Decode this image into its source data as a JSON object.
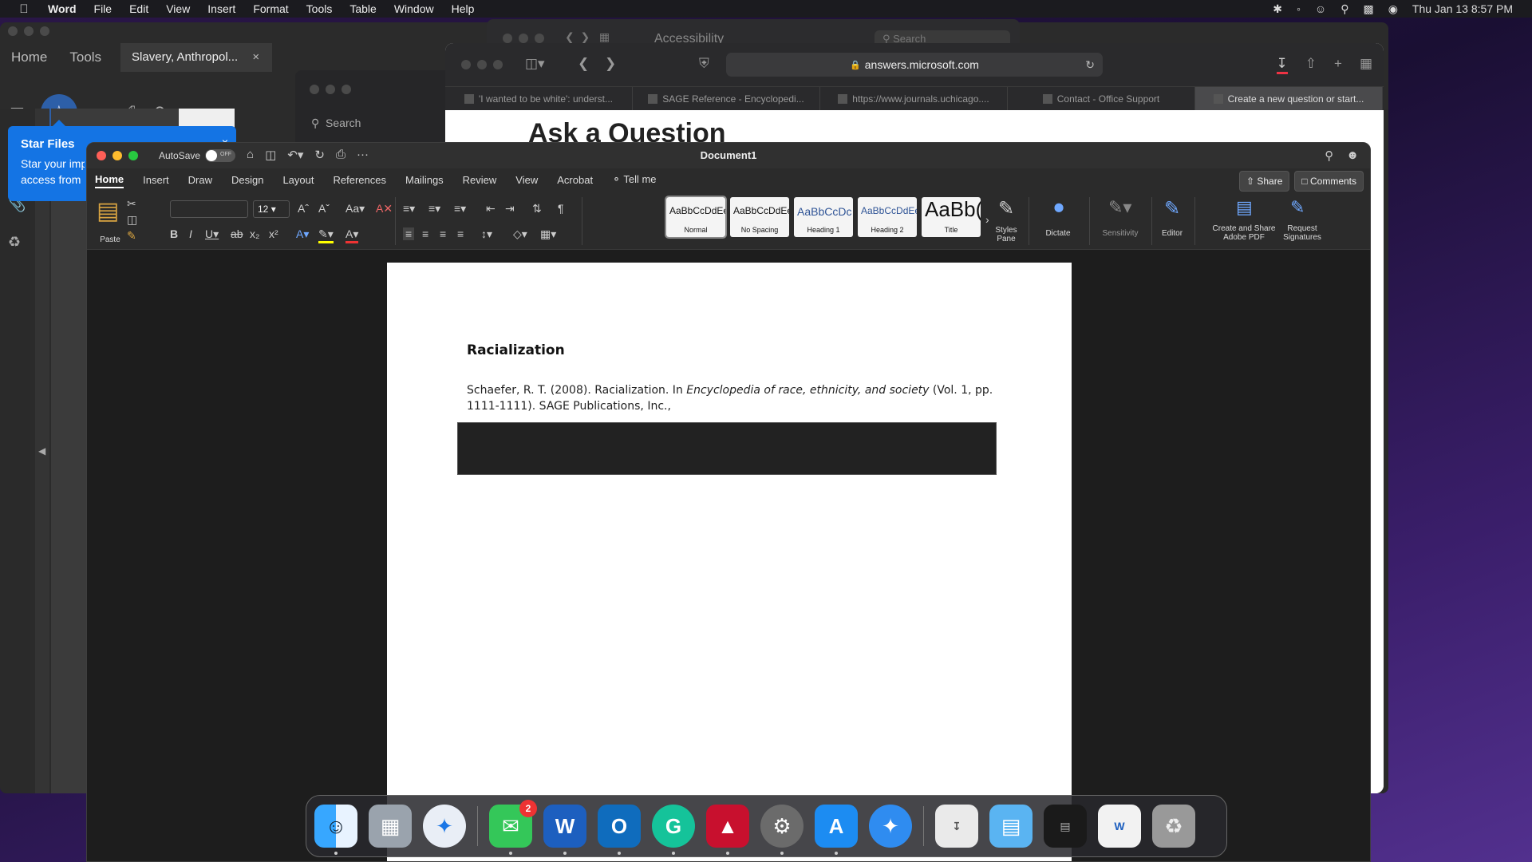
{
  "menubar": {
    "app": "Word",
    "items": [
      "File",
      "Edit",
      "View",
      "Insert",
      "Format",
      "Tools",
      "Table",
      "Window",
      "Help"
    ],
    "clock": "Thu Jan 13  8:57 PM"
  },
  "acrobat": {
    "tabs": {
      "home": "Home",
      "tools": "Tools",
      "doc": "Slavery, Anthropol...",
      "close": "×"
    },
    "star_popup": {
      "title": "Star Files",
      "text_line1": "Star your imp",
      "text_line2": "access from",
      "close": "×"
    }
  },
  "accessibility_window": {
    "title": "Accessibility",
    "search_placeholder": "Search"
  },
  "finder": {
    "search_placeholder": "Search"
  },
  "safari": {
    "url": "answers.microsoft.com",
    "tabs": [
      {
        "label": "'I wanted to be white': underst..."
      },
      {
        "label": "SAGE Reference - Encyclopedi..."
      },
      {
        "label": "https://www.journals.uchicago...."
      },
      {
        "label": "Contact - Office Support"
      },
      {
        "label": "Create a new question or start..."
      }
    ],
    "heading": "Ask a Question"
  },
  "word": {
    "title": "Document1",
    "autosave_label": "AutoSave",
    "autosave_state": "OFF",
    "tabs": [
      "Home",
      "Insert",
      "Draw",
      "Design",
      "Layout",
      "References",
      "Mailings",
      "Review",
      "View",
      "Acrobat"
    ],
    "tell_me": "Tell me",
    "share": "Share",
    "comments": "Comments",
    "paste_label": "Paste",
    "font_size": "12",
    "styles": [
      {
        "preview": "AaBbCcDdEe",
        "name": "Normal"
      },
      {
        "preview": "AaBbCcDdEe",
        "name": "No Spacing"
      },
      {
        "preview": "AaBbCcDc",
        "name": "Heading 1"
      },
      {
        "preview": "AaBbCcDdEe",
        "name": "Heading 2"
      },
      {
        "preview": "AaBb(",
        "name": "Title"
      }
    ],
    "styles_pane": "Styles Pane",
    "dictate": "Dictate",
    "sensitivity": "Sensitivity",
    "editor": "Editor",
    "create_pdf": "Create and Share Adobe PDF",
    "request_signatures": "Request Signatures",
    "document": {
      "heading": "Racialization",
      "citation_pre": "Schaefer, R. T. (2008). Racialization. In ",
      "citation_italic": "Encyclopedia of race, ethnicity, and society",
      "citation_post": " (Vol. 1, pp. 1111-1111). SAGE Publications, Inc.,"
    }
  },
  "dock": {
    "messages_badge": "2",
    "apps": [
      "finder-icon",
      "launchpad-icon",
      "safari-icon",
      "messages-icon",
      "word-icon",
      "outlook-icon",
      "grammarly-icon",
      "acrobat-icon",
      "system-preferences-icon",
      "app-store-icon",
      "safari-tech-preview-icon",
      "downloads-icon",
      "folder-icon",
      "terminal-window-icon",
      "word-doc-window-icon",
      "trash-icon"
    ]
  },
  "colors": {
    "accent_blue": "#1474e4",
    "word_bg": "#1f1f1f",
    "messages_green": "#34c759",
    "acrobat_red": "#c8102e"
  }
}
